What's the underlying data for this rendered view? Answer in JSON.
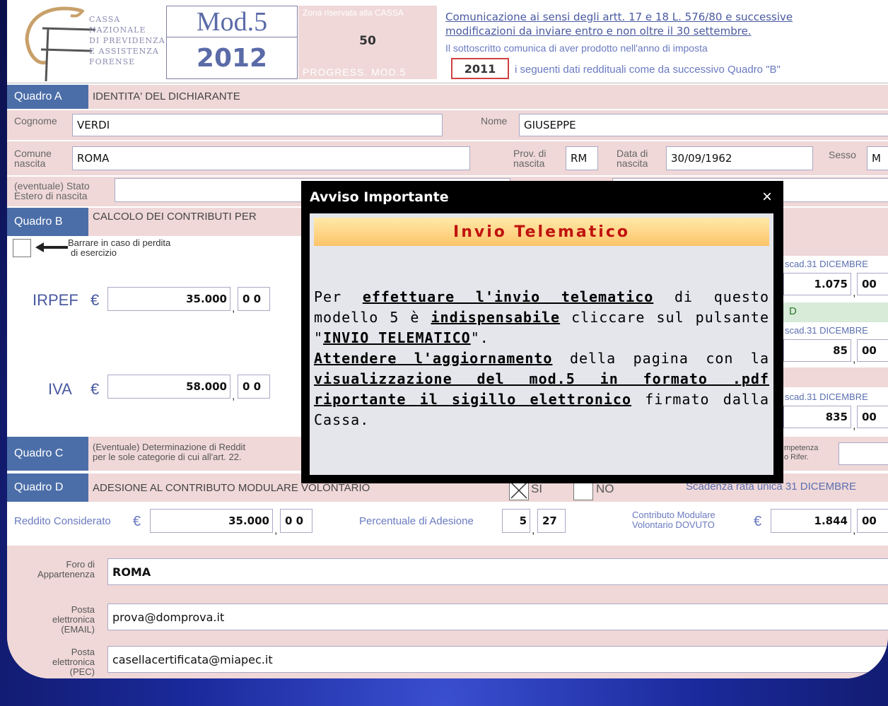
{
  "logo": {
    "line1": "CASSA",
    "line2": "NAZIONALE",
    "line3": "DI PREVIDENZA",
    "line4": "E ASSISTENZA",
    "line5": "FORENSE"
  },
  "header": {
    "mod_title": "Mod.5",
    "year": "2012",
    "zona_label": "Zona riservata alla CASSA",
    "zona_value": "50",
    "progress_label": "PROGRESS. MOD.5",
    "comunicazione_line1": "Comunicazione ai sensi degli artt. 17 e 18 L. 576/80 e successive",
    "comunicazione_line2": "modificazioni da inviare entro e non oltre il 30 settembre.",
    "sottoscritto": "Il sottoscritto comunica di aver prodotto nell'anno di imposta",
    "anno": "2011",
    "seguenti": "i seguenti dati reddituali come da successivo Quadro \"B\""
  },
  "quadro_a": {
    "tag": "Quadro A",
    "title": "IDENTITA' DEL DICHIARANTE",
    "cognome_label": "Cognome",
    "cognome": "VERDI",
    "nome_label": "Nome",
    "nome": "GIUSEPPE",
    "comune_label1": "Comune",
    "comune_label2": "nascita",
    "comune": "ROMA",
    "prov_label1": "Prov. di",
    "prov_label2": "nascita",
    "prov": "RM",
    "data_label1": "Data di",
    "data_label2": "nascita",
    "data": "30/09/1962",
    "sesso_label": "Sesso",
    "sesso": "M",
    "stato_label1": "(eventuale) Stato",
    "stato_label2": "Estero di nascita"
  },
  "quadro_b": {
    "tag": "Quadro B",
    "title": "CALCOLO DEI CONTRIBUTI PER",
    "perdita_label1": "Barrare in caso di perdita",
    "perdita_label2": "di esercizio",
    "irpef_label": "IRPEF",
    "irpef_currency": "€",
    "irpef_value": "35.000",
    "irpef_dec": "0 0",
    "iva_label": "IVA",
    "iva_currency": "€",
    "iva_value": "58.000",
    "iva_dec": "0 0",
    "scad1": "scad.31 DICEMBRE",
    "val1": "1.075",
    "dec1": "00",
    "scad2": "scad.31 DICEMBRE",
    "val2": "85",
    "dec2": "00",
    "scad3": "scad.31 DICEMBRE",
    "val3": "835",
    "dec3": "00",
    "d_letter": "D"
  },
  "quadro_c": {
    "tag": "Quadro C",
    "line1": "(Eventuale) Determinazione di Reddit",
    "line2": "per le sole categorie di cui all'art. 22.",
    "comp1": "mpetenza",
    "comp2": "o Rifer."
  },
  "quadro_d": {
    "tag": "Quadro D",
    "title": "ADESIONE AL CONTRIBUTO MODULARE VOLONTARIO",
    "si_label": "SI",
    "no_label": "NO",
    "scadenza": "Scadenza rata unica 31 DICEMBRE",
    "reddito_label": "Reddito Considerato",
    "reddito_currency": "€",
    "reddito_value": "35.000",
    "reddito_dec": "0 0",
    "perc_label": "Percentuale di Adesione",
    "perc_int": "5",
    "perc_dec": "27",
    "contrib_label1": "Contributo Modulare",
    "contrib_label2": "Volontario DOVUTO",
    "contrib_currency": "€",
    "contrib_value": "1.844",
    "contrib_dec": "00"
  },
  "footer": {
    "foro_label1": "Foro di",
    "foro_label2": "Appartenenza",
    "foro": "ROMA",
    "email_label1": "Posta",
    "email_label2": "elettronica",
    "email_label3": "(EMAIL)",
    "email": "prova@domprova.it",
    "pec_label1": "Posta",
    "pec_label2": "elettronica",
    "pec_label3": "(PEC)",
    "pec": "casellacertificata@miapec.it"
  },
  "dialog": {
    "title": "Avviso Importante",
    "close": "×",
    "banner": "Invio Telematico",
    "t1": "Per ",
    "u1": "effettuare l'invio telematico",
    "t2": " di questo modello 5 è ",
    "u2": "indispensabile",
    "t3": " cliccare sul pulsante \"",
    "u3": "INVIO TELEMATICO",
    "t4": "\".",
    "u4": "Attendere l'aggiornamento",
    "t5": " della pagina con la ",
    "u5": "visualizzazione del mod.5 in formato .pdf riportante il sigillo elettronico",
    "t6": " firmato dalla Cassa."
  },
  "colors": {
    "header_blue": "#4b6ea8",
    "band_pink": "#f0d8d8",
    "dialog_title_red": "#c0130f"
  }
}
